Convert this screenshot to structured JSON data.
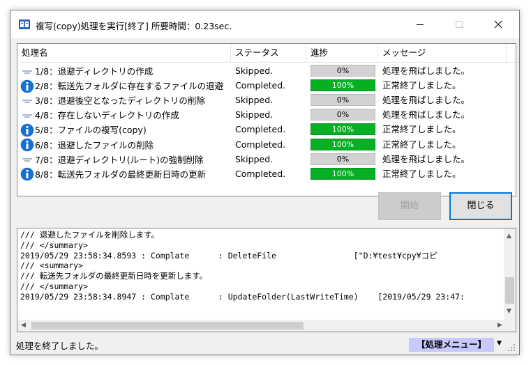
{
  "window": {
    "title": "複写(copy)処理を実行[終了] 所要時間：0.23sec."
  },
  "grid": {
    "headers": {
      "name": "処理名",
      "status": "ステータス",
      "progress": "進捗",
      "message": "メッセージ"
    },
    "rows": [
      {
        "icon": "lines-icon",
        "name": "1/8：退避ディレクトリの作成",
        "status": "Skipped.",
        "progress": 0,
        "progress_label": "0%",
        "message": "処理を飛ばしました。"
      },
      {
        "icon": "info-icon",
        "name": "2/8：転送先フォルダに存在するファイルの退避",
        "status": "Completed.",
        "progress": 100,
        "progress_label": "100%",
        "message": "正常終了しました。"
      },
      {
        "icon": "lines-icon",
        "name": "3/8：退避後空となったディレクトリの削除",
        "status": "Skipped.",
        "progress": 0,
        "progress_label": "0%",
        "message": "処理を飛ばしました。"
      },
      {
        "icon": "lines-icon",
        "name": "4/8：存在しないディレクトリの作成",
        "status": "Skipped.",
        "progress": 0,
        "progress_label": "0%",
        "message": "処理を飛ばしました。"
      },
      {
        "icon": "info-icon",
        "name": "5/8：ファイルの複写(copy)",
        "status": "Completed.",
        "progress": 100,
        "progress_label": "100%",
        "message": "正常終了しました。"
      },
      {
        "icon": "info-icon",
        "name": "6/8：退避したファイルの削除",
        "status": "Completed.",
        "progress": 100,
        "progress_label": "100%",
        "message": "正常終了しました。"
      },
      {
        "icon": "lines-icon",
        "name": "7/8：退避ディレクトリ(ルート)の強制削除",
        "status": "Skipped.",
        "progress": 0,
        "progress_label": "0%",
        "message": "処理を飛ばしました。"
      },
      {
        "icon": "info-icon",
        "name": "8/8：転送先フォルダの最終更新日時の更新",
        "status": "Completed.",
        "progress": 100,
        "progress_label": "100%",
        "message": "正常終了しました。"
      }
    ]
  },
  "buttons": {
    "start": "開始",
    "close": "閉じる"
  },
  "log": {
    "lines": [
      "/// 退避したファイルを削除します。",
      "/// </summary>",
      "2019/05/29 23:58:34.8593 : Complate      : DeleteFile                [\"D:¥test¥cpy¥コピ",
      "/// <summary>",
      "/// 転送先フォルダの最終更新日時を更新します。",
      "/// </summary>",
      "2019/05/29 23:58:34.8947 : Complate      : UpdateFolder(LastWriteTime)    [2019/05/29 23:47:"
    ]
  },
  "status": {
    "text": "処理を終了しました。",
    "menu_label": "【処理メニュー】"
  },
  "colors": {
    "progress_fill": "#06b025",
    "info_icon": "#1570d6",
    "menu_bg": "#c8c8ff",
    "focus_border": "#0078d7"
  }
}
